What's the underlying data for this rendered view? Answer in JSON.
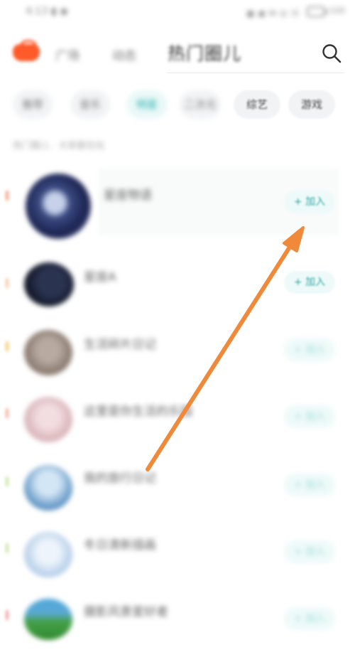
{
  "status_bar": {
    "left": "4:13 ▮ ◉",
    "right": "▣ ◉ ✉ ◎ ⓦ",
    "battery": "100"
  },
  "header": {
    "tabs": [
      "广场",
      "动态"
    ],
    "title": "热门圈儿"
  },
  "categories": [
    "推荐",
    "音乐",
    "明星",
    "二次元",
    "综艺",
    "游戏"
  ],
  "subtitle": "热门圈儿 · 大家都在玩",
  "list": [
    {
      "name": "星座物语",
      "join": "+ 加入"
    },
    {
      "name": "星座A",
      "join": "+ 加入"
    },
    {
      "name": "生活碎片日记",
      "join": "+ 加入"
    },
    {
      "name": "这里是你生活的乐园",
      "join": "+ 加入"
    },
    {
      "name": "我的旅行日记",
      "join": "+ 加入"
    },
    {
      "name": "冬日清新插画",
      "join": "+ 加入"
    },
    {
      "name": "摄影风景爱好者",
      "join": "+ 加入"
    }
  ],
  "colors": {
    "accent": "#2aa6a2",
    "brand": "#ff5a2a",
    "annotation_arrow": "#f08a3a"
  }
}
